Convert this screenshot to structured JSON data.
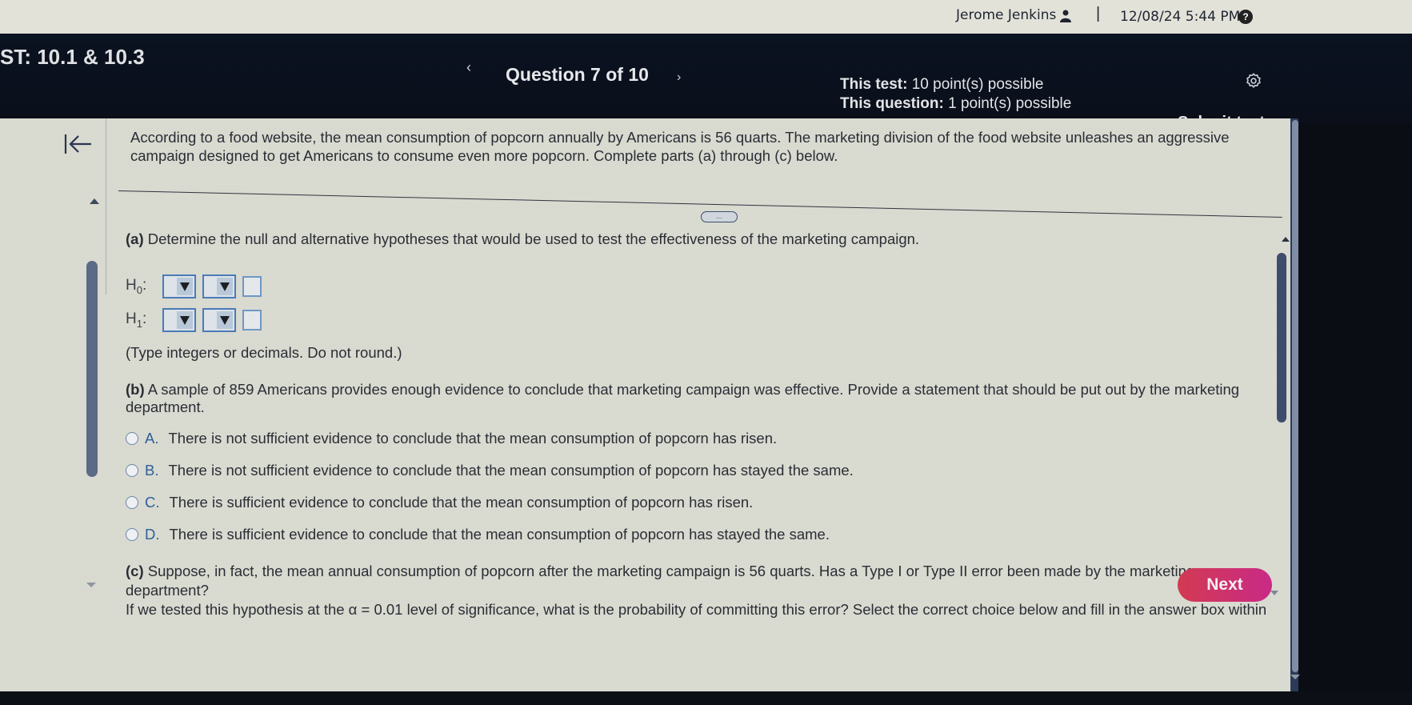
{
  "topbar": {
    "user_name": "Jerome Jenkins",
    "user_icon": "person-icon",
    "separator": "|",
    "datetime": "12/08/24 5:44 PM",
    "help_icon": "?"
  },
  "header": {
    "test_title": "ST: 10.1 & 10.3",
    "prev_glyph": "‹",
    "question_counter": "Question 7 of 10",
    "next_glyph": "›",
    "test_points_label": "This test:",
    "test_points_value": "10 point(s) possible",
    "question_points_label": "This question:",
    "question_points_value": "1 point(s) possible",
    "settings_icon": "gear-icon",
    "submit_label": "Submit test"
  },
  "question": {
    "intro": "According to a food website, the mean consumption of popcorn annually by Americans is 56 quarts. The marketing division of the food website unleashes an aggressive campaign designed to get Americans to consume even more popcorn. Complete parts (a) through (c) below.",
    "divider_handle": "...",
    "part_a_label": "(a)",
    "part_a_text": "Determine the null and alternative hypotheses that would be used to test the effectiveness of the marketing campaign.",
    "hypotheses": [
      {
        "label": "H",
        "sub": "0",
        "select1": "",
        "select2": "",
        "value": ""
      },
      {
        "label": "H",
        "sub": "1",
        "select1": "",
        "select2": "",
        "value": ""
      }
    ],
    "note": "(Type integers or decimals. Do not round.)",
    "part_b_label": "(b)",
    "part_b_text": "A sample of 859 Americans provides enough evidence to conclude that marketing campaign was effective. Provide a statement that should be put out by the marketing department.",
    "options": [
      {
        "letter": "A.",
        "text": "There is not sufficient evidence to conclude that the mean consumption of popcorn has risen."
      },
      {
        "letter": "B.",
        "text": "There is not sufficient evidence to conclude that the mean consumption of popcorn has stayed the same."
      },
      {
        "letter": "C.",
        "text": "There is sufficient evidence to conclude that the mean consumption of popcorn has risen."
      },
      {
        "letter": "D.",
        "text": "There is sufficient evidence to conclude that the mean consumption of popcorn has stayed the same."
      }
    ],
    "part_c_label": "(c)",
    "part_c_line1": "Suppose, in fact, the mean annual consumption of popcorn after the marketing campaign is 56 quarts. Has a Type I or Type II error been made by the marketing department?",
    "part_c_line2": "If we tested this hypothesis at the α = 0.01 level of significance, what is the probability of committing this error? Select the correct choice below and fill in the answer box within"
  },
  "footer": {
    "next_label": "Next"
  },
  "colors": {
    "header_bg": "#0b1220",
    "content_bg": "#d8d9cf",
    "next_button": "#cf2f6a",
    "option_letter": "#2e5f9b",
    "select_border": "#4a7bb7"
  }
}
